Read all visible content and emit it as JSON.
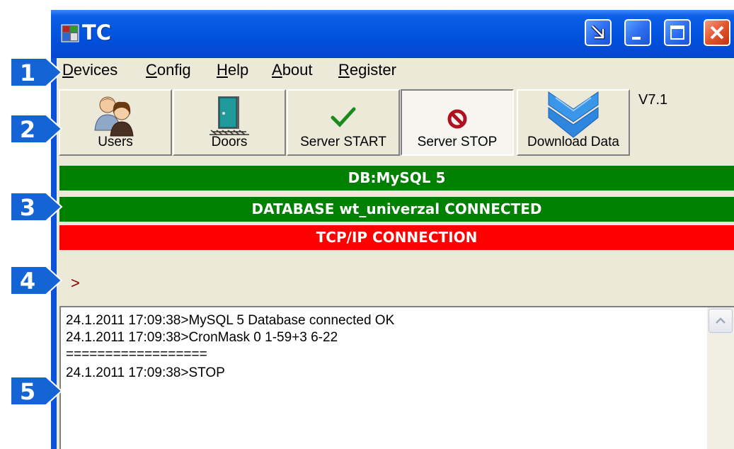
{
  "window": {
    "title": "TC"
  },
  "menu": {
    "items": [
      {
        "underline": "D",
        "rest": "evices"
      },
      {
        "underline": "C",
        "rest": "onfig"
      },
      {
        "underline": "H",
        "rest": "elp"
      },
      {
        "underline": "A",
        "rest": "bout"
      },
      {
        "underline": "R",
        "rest": "egister"
      }
    ]
  },
  "toolbar": {
    "buttons": [
      {
        "label": "Users",
        "icon": "users-icon"
      },
      {
        "label": "Doors",
        "icon": "door-icon"
      },
      {
        "label": "Server START",
        "icon": "checkmark-icon"
      },
      {
        "label": "Server STOP",
        "icon": "stop-icon",
        "pressed": true
      },
      {
        "label": "Download Data",
        "icon": "download-arrow-icon"
      }
    ],
    "version": "V7.1"
  },
  "status": {
    "db": {
      "text": "DB:MySQL 5",
      "color": "#008000"
    },
    "database": {
      "text": "DATABASE wt_univerzal CONNECTED",
      "color": "#008000"
    },
    "tcp": {
      "text": "TCP/IP CONNECTION",
      "color": "#ff0000"
    }
  },
  "prompt": ">",
  "log": {
    "lines": [
      "24.1.2011 17:09:38>MySQL 5 Database connected OK",
      "24.1.2011 17:09:38>CronMask 0 1-59+3 6-22",
      "==================",
      "24.1.2011 17:09:38>STOP"
    ]
  },
  "callouts": [
    "1",
    "2",
    "3",
    "4",
    "5"
  ],
  "colors": {
    "callout": "#1464d6",
    "titlebar": "#0051dc"
  }
}
